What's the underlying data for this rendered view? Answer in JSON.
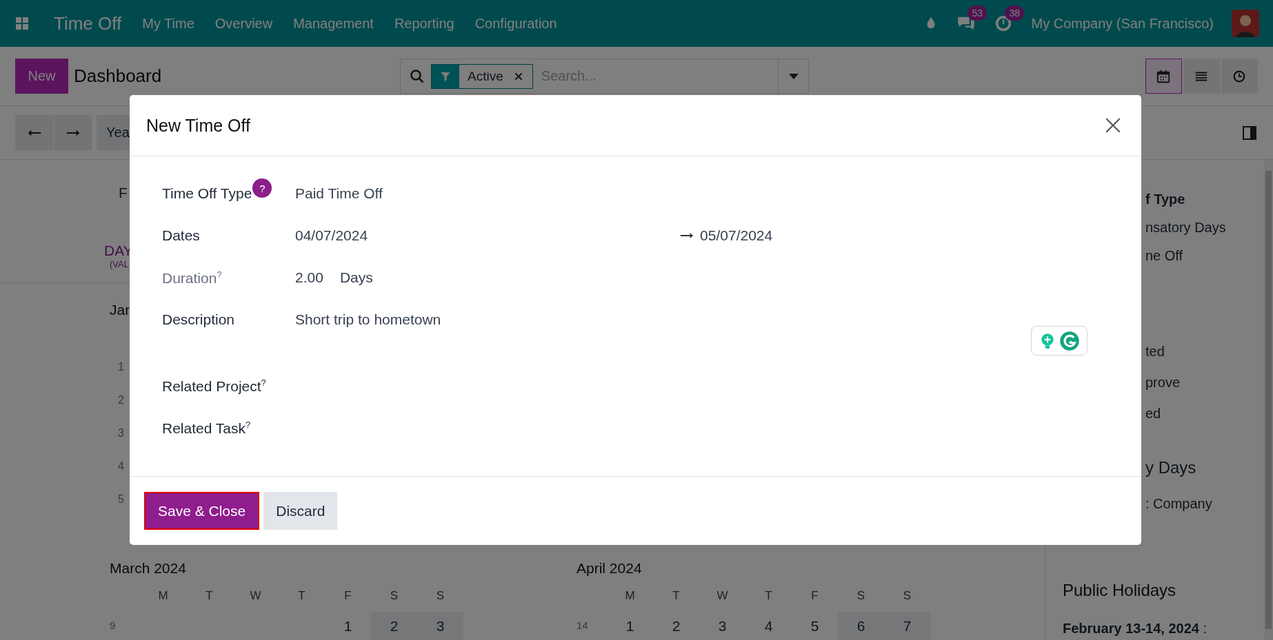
{
  "navbar": {
    "app_name": "Time Off",
    "menu": [
      "My Time",
      "Overview",
      "Management",
      "Reporting",
      "Configuration"
    ],
    "message_count": "53",
    "activity_count": "38",
    "company": "My Company (San Francisco)"
  },
  "control_panel": {
    "new_button": "New",
    "title": "Dashboard",
    "facet": "Active",
    "search_placeholder": "Search...",
    "views": [
      {
        "kind": "calendar",
        "selected": true
      },
      {
        "kind": "list",
        "selected": false
      },
      {
        "kind": "activity",
        "selected": false
      }
    ]
  },
  "toolbar": {
    "period": "Yea"
  },
  "summary": {
    "heading": "F",
    "value": "DAY",
    "note": "(VAL"
  },
  "calendar": {
    "partial_month": {
      "title": "Jan",
      "weeks": [
        "1",
        "2",
        "3",
        "4",
        "5"
      ]
    },
    "months": [
      {
        "title": "March 2024",
        "weekdays": [
          "M",
          "T",
          "W",
          "T",
          "F",
          "S",
          "S"
        ],
        "week": "9",
        "days": [
          {
            "kind": "blank"
          },
          {
            "kind": "blank"
          },
          {
            "kind": "blank"
          },
          {
            "kind": "blank"
          },
          {
            "kind": "day",
            "label": "1"
          },
          {
            "kind": "day",
            "label": "2"
          },
          {
            "kind": "day",
            "label": "3"
          }
        ]
      },
      {
        "title": "April 2024",
        "weekdays": [
          "M",
          "T",
          "W",
          "T",
          "F",
          "S",
          "S"
        ],
        "week": "14",
        "days": [
          {
            "kind": "day",
            "label": "1"
          },
          {
            "kind": "day",
            "label": "2"
          },
          {
            "kind": "day",
            "label": "3"
          },
          {
            "kind": "day",
            "label": "4"
          },
          {
            "kind": "day",
            "label": "5"
          },
          {
            "kind": "day",
            "label": "6"
          },
          {
            "kind": "day",
            "label": "7"
          }
        ]
      }
    ]
  },
  "side_panel": {
    "type_heading": "f Type",
    "types": [
      "nsatory Days",
      "ne Off"
    ],
    "states": [
      "ted",
      "prove",
      "ed"
    ],
    "mandatory_heading": "y Days",
    "mandatory_items": [
      ": Company"
    ],
    "holidays_heading": "Public Holidays",
    "holidays": [
      "**February 13-14, 2024** :"
    ]
  },
  "dialog": {
    "title": "New Time Off",
    "fields": [
      {
        "kind": "select",
        "label": "Time Off Type",
        "help": "?",
        "muted": false,
        "value": "Paid Time Off"
      },
      {
        "kind": "dates",
        "label": "Dates",
        "muted": false,
        "from": "04/07/2024",
        "to": "05/07/2024"
      },
      {
        "kind": "duration",
        "label": "Duration",
        "help": "?",
        "muted": true,
        "value": "2.00",
        "unit": "Days"
      },
      {
        "kind": "value",
        "label": "Description",
        "muted": false,
        "value": "Short trip to hometown"
      },
      {
        "kind": "empty",
        "label": "Related Project",
        "help": "?",
        "muted": false
      },
      {
        "kind": "empty",
        "label": "Related Task",
        "help": "?",
        "muted": false
      }
    ],
    "buttons": [
      {
        "label": "Save & Close",
        "primary": true
      },
      {
        "label": "Discard",
        "primary": false
      }
    ]
  }
}
